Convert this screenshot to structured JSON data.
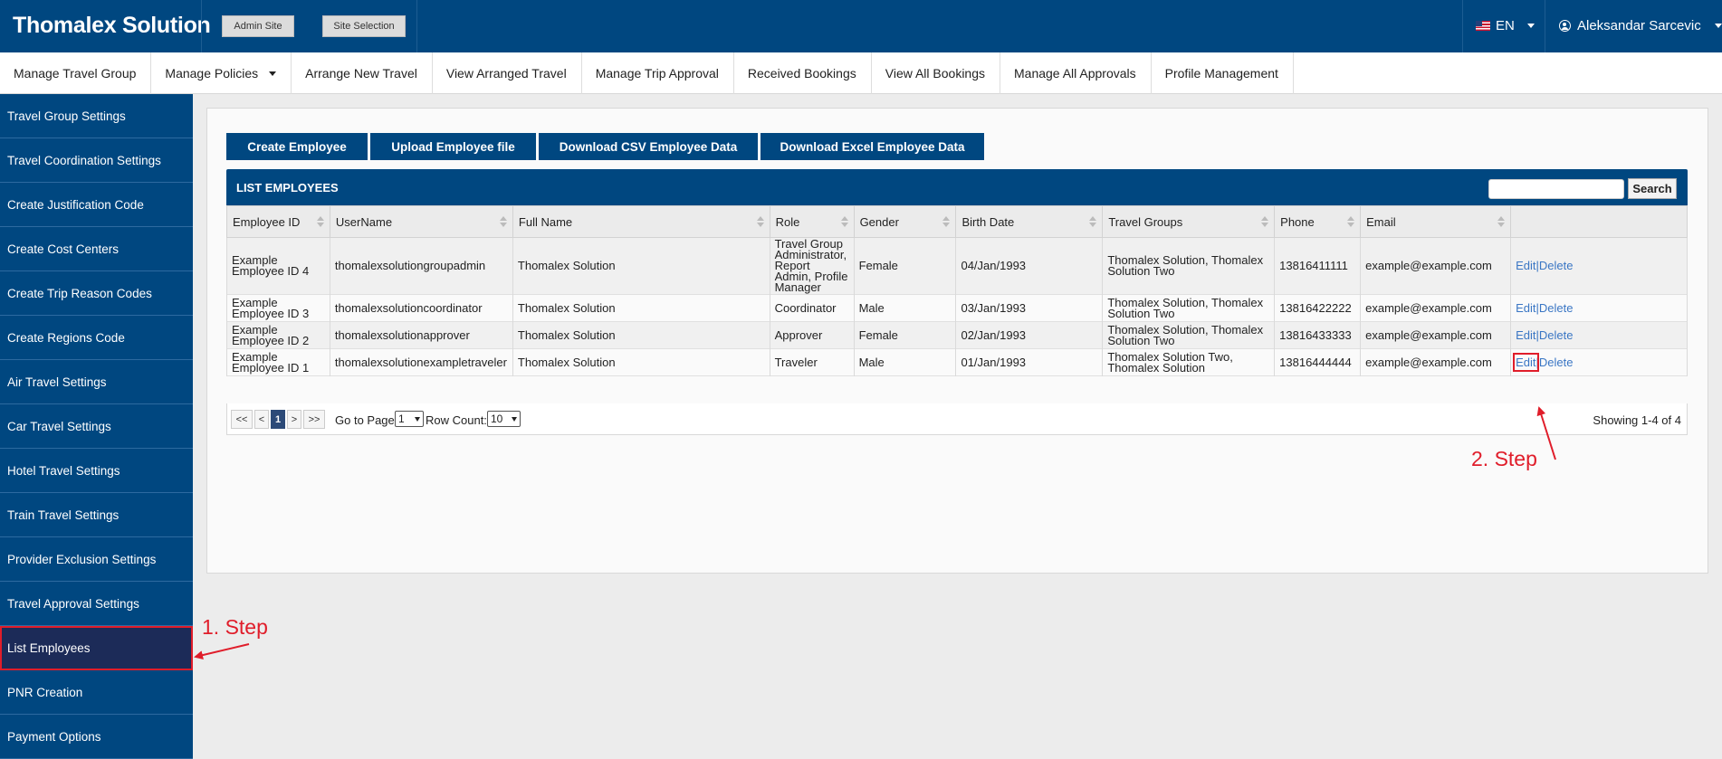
{
  "header": {
    "brand": "Thomalex Solution",
    "admin_site": "Admin Site",
    "site_selection": "Site Selection",
    "language": "EN",
    "user_name": "Aleksandar Sarcevic"
  },
  "nav": [
    {
      "label": "Manage Travel Group"
    },
    {
      "label": "Manage Policies",
      "dropdown": true
    },
    {
      "label": "Arrange New Travel"
    },
    {
      "label": "View Arranged Travel"
    },
    {
      "label": "Manage Trip Approval"
    },
    {
      "label": "Received Bookings"
    },
    {
      "label": "View All Bookings"
    },
    {
      "label": "Manage All Approvals"
    },
    {
      "label": "Profile Management"
    }
  ],
  "sidebar": [
    {
      "label": "Travel Group Settings"
    },
    {
      "label": "Travel Coordination Settings"
    },
    {
      "label": "Create Justification Code"
    },
    {
      "label": "Create Cost Centers"
    },
    {
      "label": "Create Trip Reason Codes"
    },
    {
      "label": "Create Regions Code"
    },
    {
      "label": "Air Travel Settings"
    },
    {
      "label": "Car Travel Settings"
    },
    {
      "label": "Hotel Travel Settings"
    },
    {
      "label": "Train Travel Settings"
    },
    {
      "label": "Provider Exclusion Settings"
    },
    {
      "label": "Travel Approval Settings"
    },
    {
      "label": "List Employees",
      "active": true
    },
    {
      "label": "PNR Creation"
    },
    {
      "label": "Payment Options"
    }
  ],
  "actions": [
    "Create Employee",
    "Upload Employee file",
    "Download CSV Employee Data",
    "Download Excel Employee Data"
  ],
  "list": {
    "title": "LIST EMPLOYEES",
    "search_button": "Search",
    "columns": [
      "Employee ID",
      "UserName",
      "Full Name",
      "Role",
      "Gender",
      "Birth Date",
      "Travel Groups",
      "Phone",
      "Email",
      ""
    ],
    "rows": [
      {
        "id": "Example Employee ID 4",
        "username": "thomalexsolutiongroupadmin",
        "full_name": "Thomalex Solution",
        "role": "Travel Group Administrator, Report Admin, Profile Manager",
        "gender": "Female",
        "birth": "04/Jan/1993",
        "groups": "Thomalex Solution, Thomalex Solution Two",
        "phone": "13816411111",
        "email": "example@example.com"
      },
      {
        "id": "Example Employee ID 3",
        "username": "thomalexsolutioncoordinator",
        "full_name": "Thomalex Solution",
        "role": "Coordinator",
        "gender": "Male",
        "birth": "03/Jan/1993",
        "groups": "Thomalex Solution, Thomalex Solution Two",
        "phone": "13816422222",
        "email": "example@example.com"
      },
      {
        "id": "Example Employee ID 2",
        "username": "thomalexsolutionapprover",
        "full_name": "Thomalex Solution",
        "role": "Approver",
        "gender": "Female",
        "birth": "02/Jan/1993",
        "groups": "Thomalex Solution, Thomalex Solution Two",
        "phone": "13816433333",
        "email": "example@example.com"
      },
      {
        "id": "Example Employee ID 1",
        "username": "thomalexsolutionexampletraveler",
        "full_name": "Thomalex Solution",
        "role": "Traveler",
        "gender": "Male",
        "birth": "01/Jan/1993",
        "groups": "Thomalex Solution Two, Thomalex Solution",
        "phone": "13816444444",
        "email": "example@example.com",
        "highlight_edit": true
      }
    ],
    "edit_label": "Edit",
    "delete_label": "Delete",
    "separator": "|"
  },
  "pager": {
    "first": "<<",
    "prev": "<",
    "current": "1",
    "next": ">",
    "last": ">>",
    "goto_label": "Go to Page:",
    "goto_value": "1",
    "rowcount_label": "Row Count:",
    "rowcount_value": "10",
    "showing": "Showing 1-4 of 4"
  },
  "annotations": {
    "step1": "1. Step",
    "step2": "2. Step",
    "color": "#e01d2a"
  }
}
